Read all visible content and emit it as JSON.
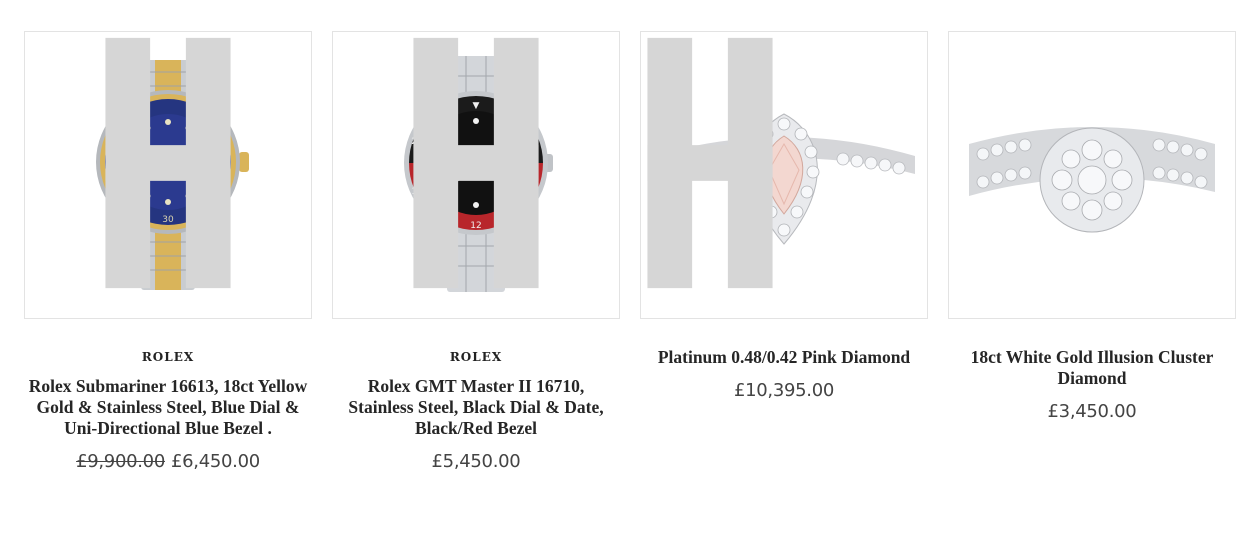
{
  "products": [
    {
      "brand": "ROLEX",
      "title": "Rolex Submariner 16613, 18ct Yellow Gold & Stainless Steel, Blue Dial & Uni-Directional Blue Bezel .",
      "price_was": "£9,900.00",
      "price": "£6,450.00",
      "image_icon": "two-tone-submariner-watch-icon",
      "colors": {
        "dial": "#2b3a8f",
        "bezel": "#253580",
        "gold": "#d9b45a",
        "steel": "#c9ccd0"
      }
    },
    {
      "brand": "ROLEX",
      "title": "Rolex GMT Master II 16710, Stainless Steel, Black Dial & Date, Black/Red Bezel",
      "price_was": "",
      "price": "£5,450.00",
      "image_icon": "gmt-master-watch-icon",
      "colors": {
        "dial": "#111111",
        "bezel_top": "#1b1b1b",
        "bezel_bottom": "#b8262b",
        "steel": "#cfd2d6"
      }
    },
    {
      "brand": "",
      "title": "Platinum 0.48/0.42 Pink Diamond",
      "price_was": "",
      "price": "£10,395.00",
      "image_icon": "pink-diamond-halo-ring-icon",
      "colors": {
        "stone": "#f3d7d0",
        "metal": "#d5d6d9"
      }
    },
    {
      "brand": "",
      "title": "18ct White Gold Illusion Cluster Diamond",
      "price_was": "",
      "price": "£3,450.00",
      "image_icon": "cluster-diamond-ring-icon",
      "colors": {
        "stone": "#f2f4f7",
        "metal": "#cfd1d4"
      }
    }
  ]
}
